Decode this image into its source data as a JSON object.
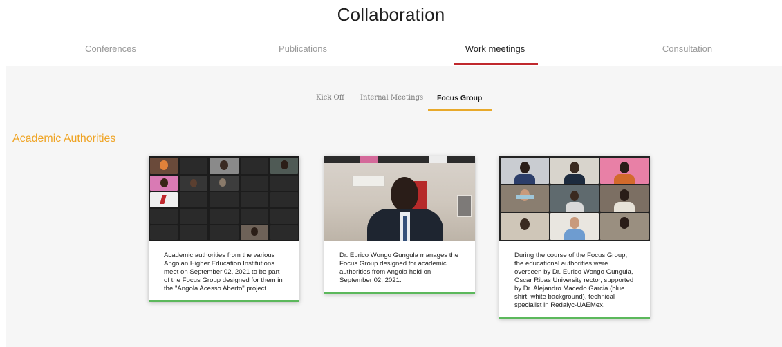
{
  "page": {
    "title": "Collaboration"
  },
  "main_tabs": [
    {
      "label": "Conferences",
      "active": false
    },
    {
      "label": "Publications",
      "active": false
    },
    {
      "label": "Work meetings",
      "active": true
    },
    {
      "label": "Consultation",
      "active": false
    }
  ],
  "sub_tabs": [
    {
      "label": "Kick Off",
      "active": false
    },
    {
      "label": "Internal Meetings",
      "active": false
    },
    {
      "label": "Focus Group",
      "active": true
    }
  ],
  "section": {
    "title": "Academic Authorities"
  },
  "cards": [
    {
      "caption": "Academic authorities from the various Angolan Higher Education Institutions meet on September 02, 2021 to be part of the Focus Group designed for them in the \"Angola Acesso Aberto\" project."
    },
    {
      "caption": "Dr. Eurico Wongo Gungula manages the Focus Group designed for academic authorities from Angola held on September 02, 2021."
    },
    {
      "caption": "During the course of the Focus Group, the educational authorities were overseen by Dr. Eurico Wongo Gungula, Oscar Ribas University rector, supported by Dr. Alejandro Macedo Garcia (blue shirt, white background), technical specialist in Redalyc-UAEMex."
    }
  ],
  "colors": {
    "main_tab_underline": "#c0282d",
    "sub_tab_underline": "#e8a92a",
    "section_title": "#efa425",
    "card_border": "#5cb85c"
  }
}
